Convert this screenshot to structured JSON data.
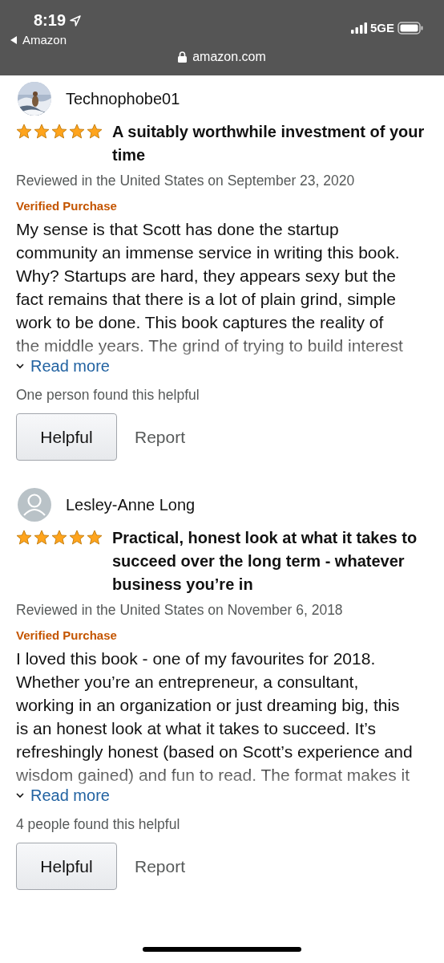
{
  "status_bar": {
    "time": "8:19",
    "back_label": "Amazon",
    "network": "5GE",
    "url": "amazon.com"
  },
  "reviews": [
    {
      "author": "Technophobe01",
      "stars": 5,
      "title": "A suitably worthwhile investment of your time",
      "meta": "Reviewed in the United States on September 23, 2020",
      "badge": "Verified Purchase",
      "body": "My sense is that Scott has done the startup\ncommunity an immense service in writing this book.\nWhy? Startups are hard, they appears sexy but the\nfact remains that there is a lot of plain grind, simple\nwork to be done. This book captures the reality of\nthe middle years. The grind of trying to build interest",
      "read_more": "Read more",
      "helpful_count": "One person found this helpful",
      "helpful_button": "Helpful",
      "report": "Report"
    },
    {
      "author": "Lesley-Anne Long",
      "avatar": {
        "kind": "default"
      },
      "stars": 5,
      "title": "Practical, honest look at what it takes to succeed over the long term - whatever business you’re in",
      "meta": "Reviewed in the United States on November 6, 2018",
      "badge": "Verified Purchase",
      "body": "I loved this book - one of my favourites for 2018.\nWhether you’re an entrepreneur, a consultant,\nworking in an organization or just dreaming big, this\nis an honest look at what it takes to succeed. It’s\nrefreshingly honest (based on Scott’s experience and\nwisdom gained) and fun to read. The format makes it",
      "read_more": "Read more",
      "helpful_count": "4 people found this helpful",
      "helpful_button": "Helpful",
      "report": "Report"
    }
  ]
}
